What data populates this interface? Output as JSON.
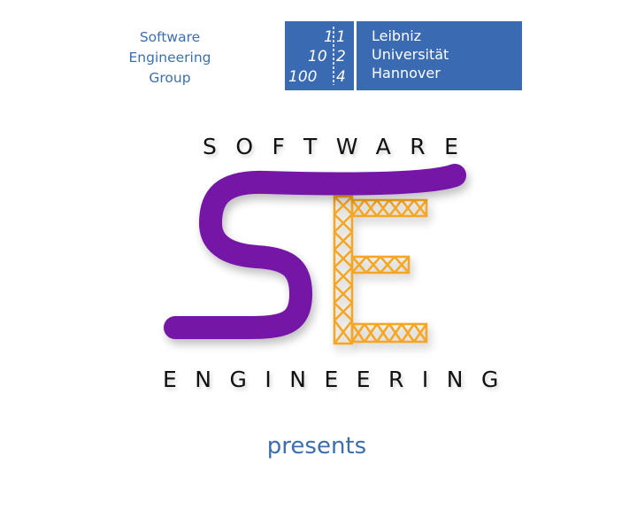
{
  "header": {
    "group_label_lines": [
      "Software",
      "Engineering",
      "Group"
    ],
    "university": {
      "name_lines": [
        "Leibniz",
        "Universität",
        "Hannover"
      ],
      "mark_rows": [
        "1|1",
        "10|2",
        "100|4"
      ]
    }
  },
  "logo": {
    "top_word": "SOFTWARE",
    "bottom_word": "ENGINEERING",
    "icon": "se-logo-icon",
    "colors": {
      "s_stroke": "#7414a6",
      "e_scaffold": "#f5a623",
      "text": "#111111",
      "accent_blue": "#3a6ab2"
    }
  },
  "footer": {
    "presents": "presents"
  }
}
